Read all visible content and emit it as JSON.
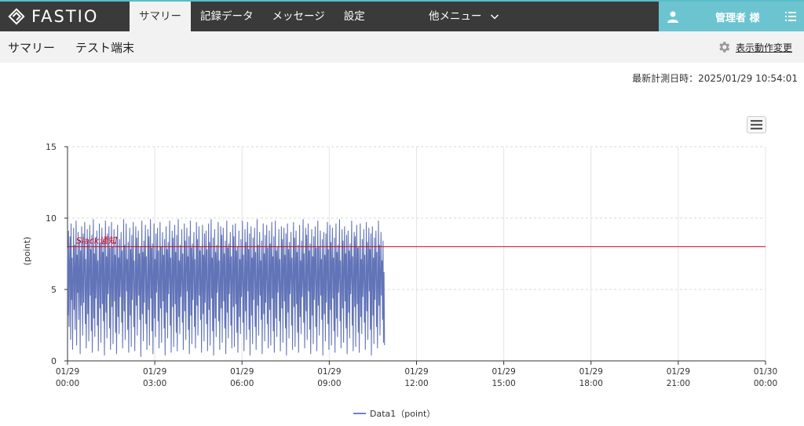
{
  "header": {
    "logo_text": "FASTIO",
    "nav": [
      {
        "label": "サマリー",
        "active": true
      },
      {
        "label": "記録データ"
      },
      {
        "label": "メッセージ"
      },
      {
        "label": "設定"
      }
    ],
    "more_label": "他メニュー",
    "user_name": "管理者 様"
  },
  "subheader": {
    "page_title": "サマリー",
    "device_name": "テスト端末",
    "display_change_label": "表示動作変更"
  },
  "timestamp": "最新計測日時：2025/01/29 10:54:01",
  "colors": {
    "topbar": "#3a3a3a",
    "accent": "#6cc4d0",
    "series": "#6274b8",
    "threshold": "#d0021b"
  },
  "chart_data": {
    "type": "line",
    "ylabel": "(point)",
    "ylim": [
      0,
      15
    ],
    "yticks": [
      0,
      5,
      10,
      15
    ],
    "xlim": [
      "2025-01-29 00:00",
      "2025-01-30 00:00"
    ],
    "xticks": [
      {
        "date": "01/29",
        "time": "00:00"
      },
      {
        "date": "01/29",
        "time": "03:00"
      },
      {
        "date": "01/29",
        "time": "06:00"
      },
      {
        "date": "01/29",
        "time": "09:00"
      },
      {
        "date": "01/29",
        "time": "12:00"
      },
      {
        "date": "01/29",
        "time": "15:00"
      },
      {
        "date": "01/29",
        "time": "18:00"
      },
      {
        "date": "01/29",
        "time": "21:00"
      },
      {
        "date": "01/30",
        "time": "00:00"
      }
    ],
    "grid": true,
    "legend_position": "bottom-center",
    "threshold": {
      "label": "Slack通知",
      "value": 8
    },
    "series": [
      {
        "name": "Data1（point）",
        "x_start": "2025-01-29 00:00",
        "x_end": "2025-01-29 10:54",
        "values": [
          7.9,
          3.2,
          9.1,
          2.4,
          6.8,
          8.7,
          1.5,
          9.6,
          4.3,
          7.2,
          0.8,
          5.9,
          9.3,
          3.6,
          8.1,
          2.2,
          6.5,
          9.8,
          1.1,
          7.4,
          4.8,
          9.0,
          2.9,
          6.2,
          8.5,
          0.5,
          7.7,
          3.9,
          9.4,
          5.2,
          1.8,
          8.9,
          4.1,
          6.9,
          9.7,
          2.6,
          7.1,
          0.9,
          5.6,
          9.2,
          3.3,
          8.3,
          1.4,
          6.4,
          9.5,
          4.6,
          7.8,
          2.1,
          8.8,
          0.6,
          5.3,
          9.9,
          3.0,
          7.5,
          1.7,
          8.6,
          4.4,
          6.1,
          9.1,
          2.5,
          7.0,
          0.7,
          5.8,
          9.6,
          3.7,
          8.2,
          1.3,
          6.7,
          9.3,
          4.0,
          7.6,
          2.8,
          8.4,
          0.4,
          5.5,
          9.8,
          3.4,
          7.3,
          1.6,
          8.9,
          4.7,
          6.0,
          9.4,
          2.3,
          7.9,
          0.8,
          5.1,
          9.7,
          3.8,
          8.0,
          1.2,
          6.6,
          9.2,
          4.2,
          7.4,
          2.0,
          8.7,
          0.5,
          5.7,
          9.5,
          3.1,
          7.2,
          1.9,
          8.5,
          4.5,
          6.3,
          9.0,
          2.7,
          7.7,
          0.9,
          5.4,
          9.9,
          3.5,
          8.1,
          1.5,
          6.8,
          9.6,
          4.9,
          7.1,
          2.2,
          8.3,
          0.6,
          5.9,
          9.3,
          3.2,
          7.8,
          1.0,
          8.8,
          4.3,
          6.5,
          9.7,
          2.4,
          7.0,
          0.7,
          5.2,
          9.4,
          3.9,
          8.6,
          1.8,
          6.2,
          9.1,
          4.6,
          7.5,
          2.9,
          8.0,
          0.3,
          5.6,
          9.8,
          3.3,
          7.6,
          1.4,
          8.4,
          4.1,
          6.9,
          9.5,
          2.6,
          7.3,
          0.8,
          5.0,
          9.2,
          3.6,
          8.7,
          1.1,
          6.4,
          9.9,
          4.4,
          7.9,
          2.1,
          8.2,
          0.5,
          5.8,
          9.6,
          3.0,
          7.1,
          1.7,
          8.9,
          4.8,
          6.1,
          9.3,
          2.8,
          7.7,
          0.9,
          5.3,
          9.7,
          3.7,
          8.0,
          1.3,
          6.6,
          9.0,
          4.2,
          7.4,
          2.3,
          8.5,
          0.4,
          5.5,
          9.4,
          3.4,
          7.8,
          1.6,
          8.3,
          4.7,
          6.3,
          9.8,
          2.5,
          7.2,
          0.6,
          5.9,
          9.1,
          3.8,
          8.6,
          1.0,
          6.7,
          9.5,
          4.0,
          7.6,
          2.0,
          8.8,
          0.7,
          5.1,
          9.9,
          3.1,
          7.0,
          1.9,
          8.1,
          4.5,
          6.0,
          9.2,
          2.7,
          7.5,
          0.8,
          5.4,
          9.6,
          3.5,
          8.4,
          1.5,
          6.5,
          9.3,
          4.9,
          7.3,
          2.2,
          8.7,
          0.5,
          5.7,
          9.8,
          3.2,
          7.9,
          1.2,
          8.2,
          4.3,
          6.8,
          9.0,
          2.4,
          7.1,
          0.9,
          5.2,
          9.7,
          3.9,
          8.5,
          1.8,
          6.2,
          9.4,
          4.6,
          7.7,
          2.9,
          8.0,
          0.6,
          5.6,
          9.5,
          3.3,
          7.4,
          1.4,
          8.9,
          4.1,
          6.4,
          9.1,
          2.6,
          7.8,
          0.7,
          5.0,
          9.6,
          3.6,
          8.3,
          1.1,
          6.9,
          9.9,
          4.4,
          7.2,
          2.1,
          8.6,
          0.4,
          5.8,
          9.2,
          3.0,
          7.6,
          1.7,
          8.1,
          4.8,
          6.1,
          9.7,
          2.8,
          7.0,
          0.8,
          5.3,
          9.4,
          3.7,
          8.8,
          1.3,
          6.6,
          9.3,
          4.2,
          7.5,
          2.3,
          8.4,
          0.5,
          5.5,
          9.8,
          3.4,
          7.9,
          1.6,
          8.2,
          4.7,
          6.3,
          9.0,
          2.5,
          7.3,
          0.9,
          5.9,
          9.5,
          3.8,
          8.7,
          1.0,
          6.7,
          9.6,
          4.0,
          7.7,
          2.0,
          8.0,
          0.6,
          5.1,
          9.1,
          3.1,
          7.1,
          1.9,
          8.5,
          4.5,
          6.0,
          9.8,
          2.7,
          7.4,
          0.7,
          5.4,
          9.2,
          3.5,
          8.3,
          1.5,
          6.5,
          9.7,
          4.9,
          7.8,
          2.2,
          8.9,
          0.4,
          5.7,
          9.4,
          3.2,
          7.2,
          1.2,
          8.6,
          4.3,
          6.8,
          9.3,
          2.4,
          7.6,
          0.8,
          5.2,
          9.9,
          3.9,
          8.1,
          1.8,
          6.2,
          9.0,
          4.6,
          7.0,
          2.9,
          8.4,
          0.5,
          5.6,
          9.6,
          3.3,
          7.5,
          1.4,
          8.8,
          4.1,
          6.4,
          9.5,
          2.6,
          7.9,
          0.9,
          5.0,
          9.1,
          3.6,
          8.2,
          1.1,
          6.9,
          9.7,
          4.4,
          7.3,
          2.1,
          8.7,
          0.6,
          5.8,
          9.8,
          3.0,
          7.7,
          1.7,
          8.0,
          4.8,
          6.1,
          9.2,
          2.8,
          7.1,
          0.7,
          5.3,
          9.4,
          3.7,
          8.5,
          1.3,
          6.6,
          9.3,
          4.2,
          7.4,
          2.3,
          8.9,
          0.4,
          5.5,
          9.6,
          3.4,
          7.8,
          1.6,
          8.3,
          4.7,
          6.3,
          9.0,
          2.5,
          7.2,
          0.8,
          5.9,
          9.7,
          3.8,
          8.6,
          1.0,
          6.7,
          9.1,
          4.0,
          7.6,
          2.0,
          8.1,
          0.6,
          5.1,
          9.5,
          3.1,
          7.0,
          1.9,
          8.4,
          4.5,
          6.0,
          9.9,
          2.7,
          7.5,
          0.9,
          5.4,
          9.3,
          3.5,
          8.8,
          1.5,
          6.5,
          9.6,
          4.9,
          7.7,
          2.2,
          8.2,
          0.5,
          5.7,
          9.2,
          3.2,
          7.3,
          1.2,
          8.7,
          4.3,
          6.8,
          9.4,
          2.4,
          7.9,
          0.7,
          5.2,
          9.8,
          3.9,
          8.0,
          1.8,
          6.2,
          9.1,
          4.6,
          7.1,
          2.9,
          8.5,
          0.4,
          5.6,
          9.0,
          3.3,
          7.4,
          1.4,
          8.9,
          4.1,
          6.4,
          9.7,
          2.6,
          7.8,
          0.8,
          5.0,
          9.5,
          3.6,
          8.3,
          1.1,
          6.9,
          9.3,
          4.4,
          7.2,
          2.1,
          8.6,
          0.6,
          5.8,
          9.6,
          3.0,
          7.6,
          1.7,
          8.1,
          4.8,
          6.1,
          9.9,
          2.8,
          7.0,
          0.9,
          5.3,
          9.2,
          3.7,
          8.4,
          1.3,
          6.6,
          9.4,
          4.2,
          7.5,
          2.3,
          8.8,
          0.5,
          5.5,
          9.1,
          3.4,
          7.7,
          1.6,
          8.2,
          4.7,
          6.3,
          9.8,
          2.5,
          7.3,
          0.7,
          5.9,
          9.0,
          3.8,
          8.7,
          1.0,
          6.7,
          9.5,
          4.0,
          7.9,
          2.0,
          8.0,
          0.6,
          5.1,
          9.6,
          3.1,
          7.1,
          1.9,
          8.5,
          4.5,
          6.0,
          9.2,
          2.7,
          7.4,
          0.8,
          5.4,
          9.7,
          3.5,
          8.3,
          1.5,
          6.5,
          9.3,
          4.9,
          7.8,
          2.2,
          8.9,
          0.4,
          5.7,
          9.4,
          3.2,
          7.2,
          1.2,
          8.6,
          4.3,
          6.8,
          9.1,
          2.4,
          7.6,
          0.9,
          5.2,
          9.8,
          3.9,
          8.1,
          1.8,
          6.2,
          9.0,
          4.6,
          7.0,
          2.9,
          8.4,
          1.3,
          6.2,
          1.1
        ]
      }
    ]
  }
}
